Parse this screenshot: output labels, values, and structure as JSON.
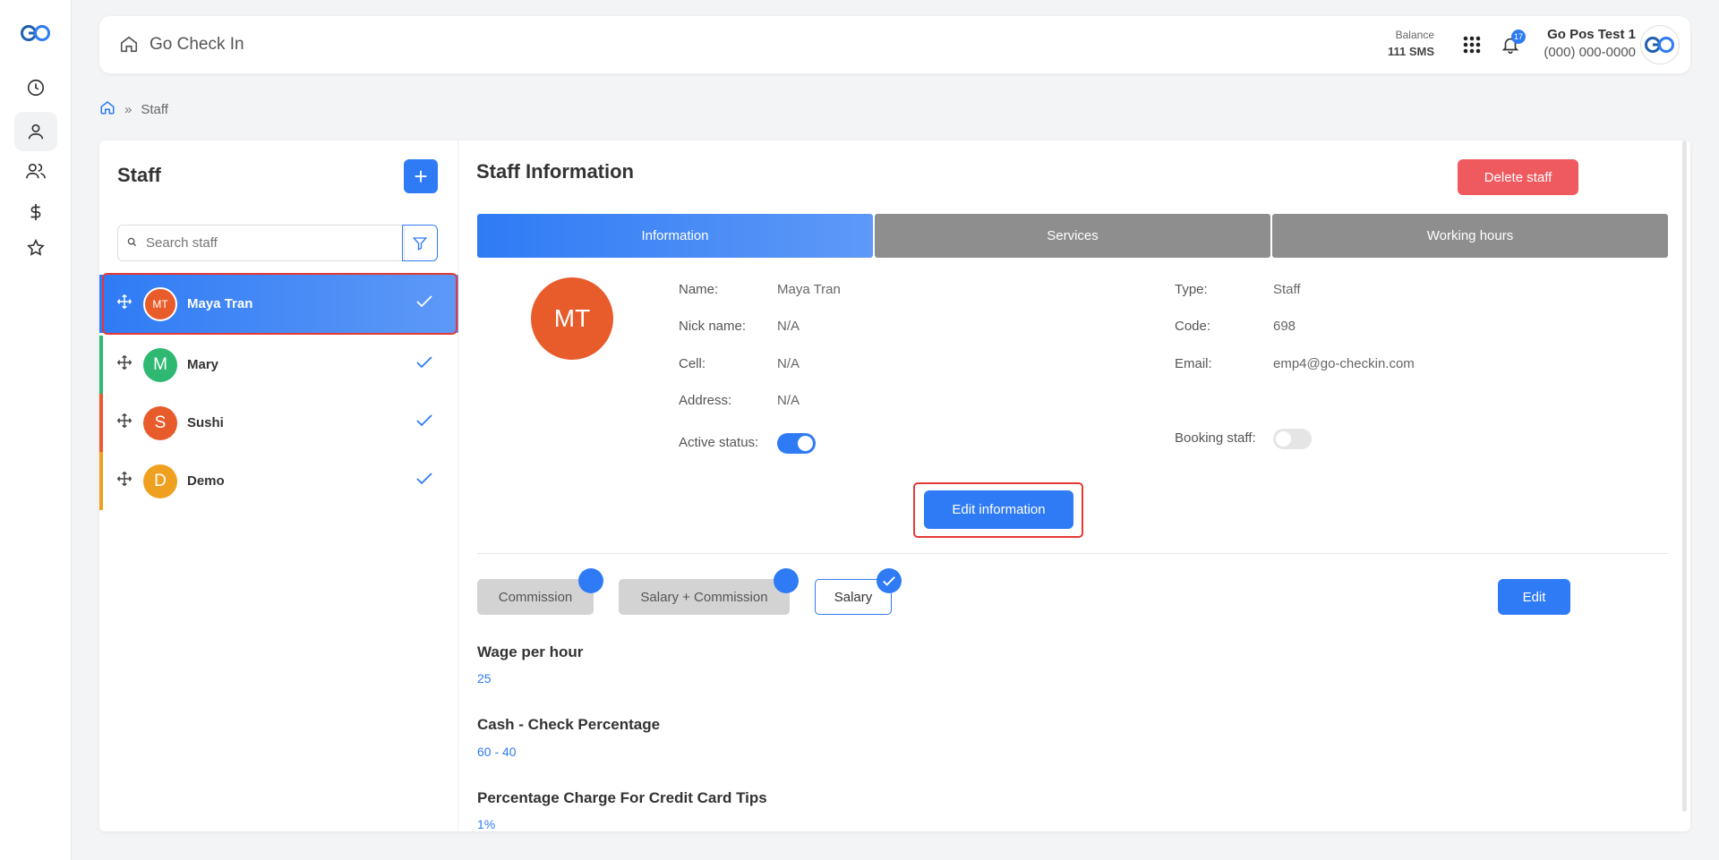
{
  "app": {
    "title": "Go Check In"
  },
  "header": {
    "balance_label": "Balance",
    "balance_value": "111 SMS",
    "notification_count": "17",
    "account_name": "Go Pos Test 1",
    "account_phone": "(000) 000-0000"
  },
  "breadcrumb": {
    "separator": "»",
    "current": "Staff"
  },
  "staff_list": {
    "title": "Staff",
    "search_placeholder": "Search staff",
    "items": [
      {
        "initials": "MT",
        "name": "Maya Tran",
        "color": "#e85c2c",
        "bar": "#2f7bf5",
        "selected": true
      },
      {
        "initials": "M",
        "name": "Mary",
        "color": "#2eb872",
        "bar": "#2eb872",
        "selected": false
      },
      {
        "initials": "S",
        "name": "Sushi",
        "color": "#e85c2c",
        "bar": "#e85c2c",
        "selected": false
      },
      {
        "initials": "D",
        "name": "Demo",
        "color": "#f0a020",
        "bar": "#f0a020",
        "selected": false
      }
    ]
  },
  "info": {
    "title": "Staff Information",
    "delete_label": "Delete staff",
    "tabs": [
      "Information",
      "Services",
      "Working hours"
    ],
    "avatar_initials": "MT",
    "fields_left": {
      "name_label": "Name:",
      "name_value": "Maya Tran",
      "nick_label": "Nick name:",
      "nick_value": "N/A",
      "cell_label": "Cell:",
      "cell_value": "N/A",
      "address_label": "Address:",
      "address_value": "N/A",
      "active_label": "Active status:",
      "active_on": true
    },
    "fields_right": {
      "type_label": "Type:",
      "type_value": "Staff",
      "code_label": "Code:",
      "code_value": "698",
      "email_label": "Email:",
      "email_value": "emp4@go-checkin.com",
      "booking_label": "Booking staff:",
      "booking_on": false
    },
    "edit_info_label": "Edit information",
    "pay_types": [
      "Commission",
      "Salary + Commission",
      "Salary"
    ],
    "pay_selected": "Salary",
    "edit_label": "Edit",
    "settings": [
      {
        "title": "Wage per hour",
        "value": "25"
      },
      {
        "title": "Cash - Check Percentage",
        "value": "60 - 40"
      },
      {
        "title": "Percentage Charge For Credit Card Tips",
        "value": "1%"
      }
    ]
  },
  "colors": {
    "primary": "#2f7bf5",
    "danger": "#ef5a5f",
    "highlight": "#e53935"
  }
}
